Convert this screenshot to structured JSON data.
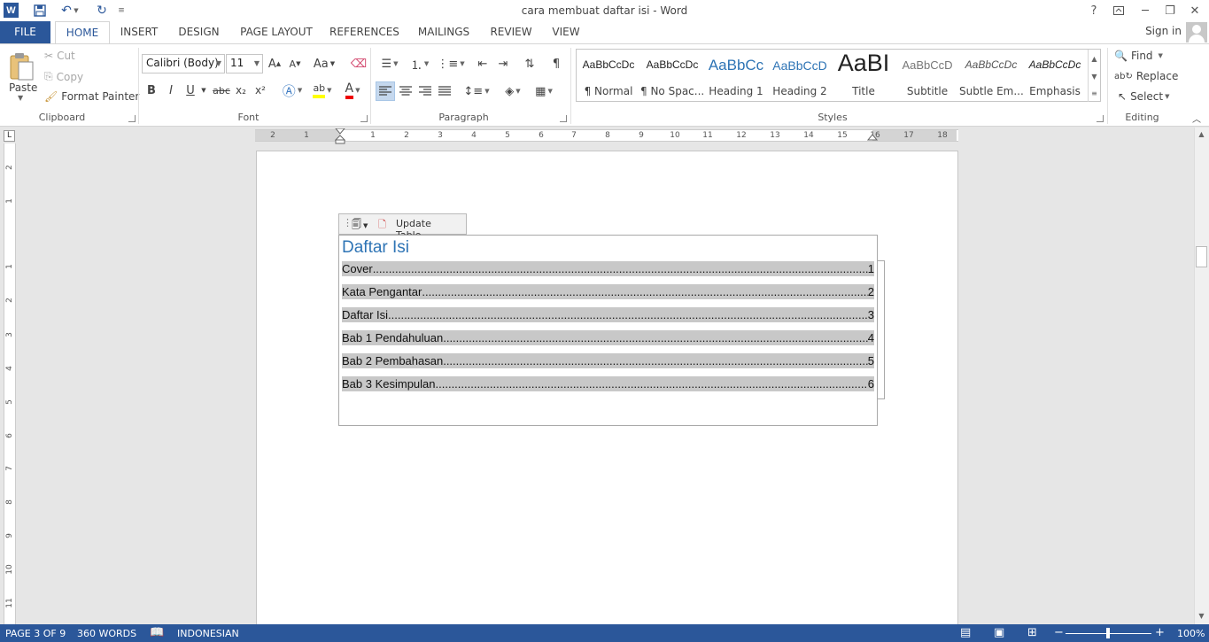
{
  "window": {
    "title": "cara membuat daftar isi - Word",
    "help": "?",
    "signin": "Sign in"
  },
  "tabs": [
    "FILE",
    "HOME",
    "INSERT",
    "DESIGN",
    "PAGE LAYOUT",
    "REFERENCES",
    "MAILINGS",
    "REVIEW",
    "VIEW"
  ],
  "active_tab": "HOME",
  "clipboard": {
    "paste": "Paste",
    "cut": "Cut",
    "copy": "Copy",
    "format_painter": "Format Painter",
    "label": "Clipboard"
  },
  "font": {
    "name": "Calibri (Body)",
    "size": "11",
    "label": "Font",
    "bold": "B",
    "italic": "I",
    "underline": "U",
    "strike": "abc",
    "subscript": "x₂",
    "superscript": "x²",
    "grow": "A",
    "shrink": "A",
    "case": "Aa"
  },
  "paragraph": {
    "label": "Paragraph"
  },
  "styles": {
    "label": "Styles",
    "items": [
      {
        "preview": "AaBbCcDc",
        "name": "¶ Normal"
      },
      {
        "preview": "AaBbCcDc",
        "name": "¶ No Spac..."
      },
      {
        "preview": "AaBbCc",
        "name": "Heading 1"
      },
      {
        "preview": "AaBbCcD",
        "name": "Heading 2"
      },
      {
        "preview": "AaBI",
        "name": "Title"
      },
      {
        "preview": "AaBbCcD",
        "name": "Subtitle"
      },
      {
        "preview": "AaBbCcDc",
        "name": "Subtle Em..."
      },
      {
        "preview": "AaBbCcDc",
        "name": "Emphasis"
      }
    ]
  },
  "editing": {
    "find": "Find",
    "replace": "Replace",
    "select": "Select",
    "label": "Editing"
  },
  "ruler": {
    "h": [
      "2",
      "1",
      "1",
      "2",
      "3",
      "4",
      "5",
      "6",
      "7",
      "8",
      "9",
      "10",
      "11",
      "12",
      "13",
      "14",
      "15",
      "16",
      "17",
      "18"
    ],
    "v": [
      "2",
      "1",
      "1",
      "2",
      "3",
      "4",
      "5",
      "6",
      "7",
      "8",
      "9",
      "10",
      "11"
    ],
    "tab_selector": "L"
  },
  "toc": {
    "update_button": "Update Table...",
    "title": "Daftar Isi",
    "entries": [
      {
        "label": "Cover ",
        "page": "1"
      },
      {
        "label": "Kata Pengantar ",
        "page": "2"
      },
      {
        "label": "Daftar Isi ",
        "page": "3"
      },
      {
        "label": "Bab 1 Pendahuluan",
        "page": "4"
      },
      {
        "label": "Bab 2 Pembahasan ",
        "page": "5"
      },
      {
        "label": "Bab 3 Kesimpulan ",
        "page": "6"
      }
    ]
  },
  "status": {
    "page": "PAGE 3 OF 9",
    "words": "360 WORDS",
    "language": "INDONESIAN",
    "zoom": "100%",
    "zoom_level": 1.0
  },
  "colors": {
    "accent": "#2b579a",
    "heading": "#2e74b5",
    "toc_highlight": "#c8c8c8"
  }
}
